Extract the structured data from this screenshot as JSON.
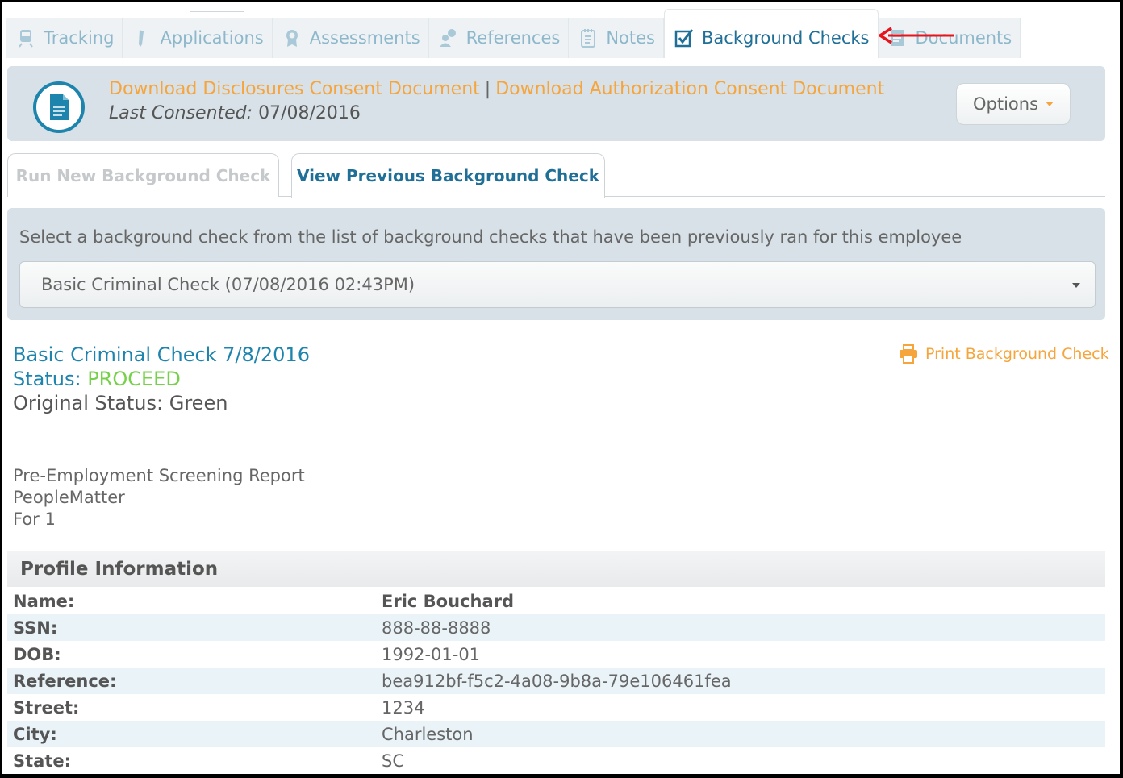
{
  "top_tabs": [
    {
      "label": "Tracking",
      "icon": "train-icon"
    },
    {
      "label": "Applications",
      "icon": "pen-icon"
    },
    {
      "label": "Assessments",
      "icon": "award-icon"
    },
    {
      "label": "References",
      "icon": "people-icon"
    },
    {
      "label": "Notes",
      "icon": "notepad-icon"
    },
    {
      "label": "Background Checks",
      "icon": "checklist-icon",
      "active": true
    },
    {
      "label": "Documents",
      "icon": "document-icon"
    }
  ],
  "consent": {
    "link_disclosures": "Download Disclosures Consent Document",
    "separator": "|",
    "link_authorization": "Download Authorization Consent Document",
    "last_consented_label": "Last Consented:",
    "last_consented_value": "07/08/2016",
    "options_label": "Options"
  },
  "sub_tabs": {
    "run_new": "Run New Background Check",
    "view_previous": "View Previous Background Check"
  },
  "select_panel": {
    "instruction": "Select a background check from the list of background checks that have been previously ran for this employee",
    "selected": "Basic Criminal Check (07/08/2016 02:43PM)"
  },
  "report": {
    "title": "Basic Criminal Check 7/8/2016",
    "status_label": "Status:",
    "status_value": "PROCEED",
    "original_status": "Original Status: Green",
    "print_label": "Print Background Check",
    "line1": "Pre-Employment Screening Report",
    "line2": "PeopleMatter",
    "line3": "For 1"
  },
  "profile": {
    "heading": "Profile Information",
    "rows": [
      {
        "key": "Name:",
        "value": "Eric Bouchard"
      },
      {
        "key": "SSN:",
        "value": "888-88-8888"
      },
      {
        "key": "DOB:",
        "value": "1992-01-01"
      },
      {
        "key": "Reference:",
        "value": "bea912bf-f5c2-4a08-9b8a-79e106461fea"
      },
      {
        "key": "Street:",
        "value": "1234"
      },
      {
        "key": "City:",
        "value": "Charleston"
      },
      {
        "key": "State:",
        "value": "SC"
      }
    ]
  },
  "colors": {
    "accent_blue": "#1d84ad",
    "link_orange": "#f6a53c",
    "status_green": "#76d14a",
    "arrow_red": "#e8141b"
  }
}
